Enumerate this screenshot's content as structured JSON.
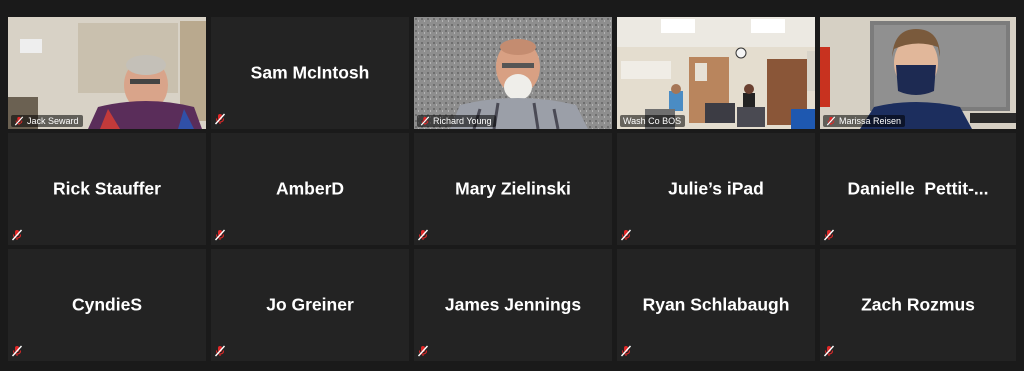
{
  "participants": [
    {
      "name": "Jack Seward",
      "video": true
    },
    {
      "name": "Sam McIntosh",
      "video": false
    },
    {
      "name": "Richard Young",
      "video": true
    },
    {
      "name": "Wash Co BOS",
      "video": true,
      "active_speaker": true
    },
    {
      "name": "Marissa Reisen",
      "video": true
    },
    {
      "name": "Rick Stauffer",
      "video": false
    },
    {
      "name": "AmberD",
      "video": false
    },
    {
      "name": "Mary Zielinski",
      "video": false
    },
    {
      "name": "Julie’s iPad",
      "video": false
    },
    {
      "name": "Danielle  Pettit-...",
      "video": false
    },
    {
      "name": "CyndieS",
      "video": false
    },
    {
      "name": "Jo Greiner",
      "video": false
    },
    {
      "name": "James Jennings",
      "video": false
    },
    {
      "name": "Ryan Schlabaugh",
      "video": false
    },
    {
      "name": "Zach Rozmus",
      "video": false
    }
  ],
  "icons": {
    "muted": "microphone-muted-icon"
  },
  "colors": {
    "active_border": "#c9e265",
    "muted_icon": "#e02828",
    "tile_bg": "#232323"
  }
}
